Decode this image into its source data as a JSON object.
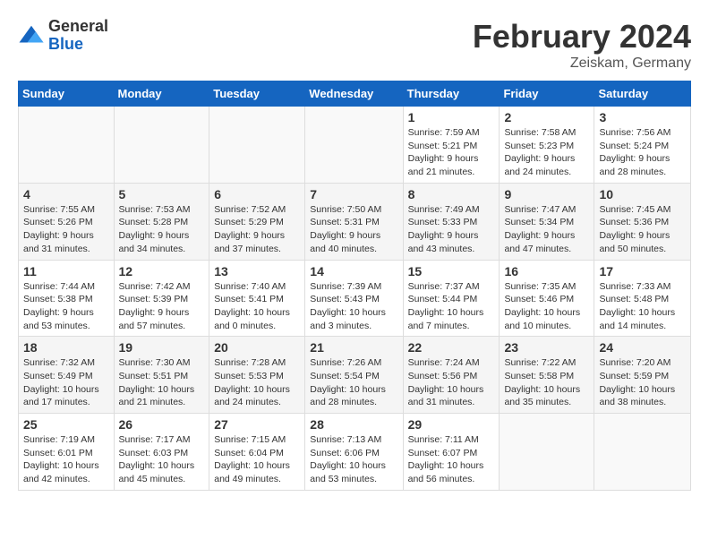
{
  "logo": {
    "general": "General",
    "blue": "Blue"
  },
  "title": "February 2024",
  "location": "Zeiskam, Germany",
  "days_header": [
    "Sunday",
    "Monday",
    "Tuesday",
    "Wednesday",
    "Thursday",
    "Friday",
    "Saturday"
  ],
  "weeks": [
    [
      {
        "day": "",
        "info": ""
      },
      {
        "day": "",
        "info": ""
      },
      {
        "day": "",
        "info": ""
      },
      {
        "day": "",
        "info": ""
      },
      {
        "day": "1",
        "info": "Sunrise: 7:59 AM\nSunset: 5:21 PM\nDaylight: 9 hours\nand 21 minutes."
      },
      {
        "day": "2",
        "info": "Sunrise: 7:58 AM\nSunset: 5:23 PM\nDaylight: 9 hours\nand 24 minutes."
      },
      {
        "day": "3",
        "info": "Sunrise: 7:56 AM\nSunset: 5:24 PM\nDaylight: 9 hours\nand 28 minutes."
      }
    ],
    [
      {
        "day": "4",
        "info": "Sunrise: 7:55 AM\nSunset: 5:26 PM\nDaylight: 9 hours\nand 31 minutes."
      },
      {
        "day": "5",
        "info": "Sunrise: 7:53 AM\nSunset: 5:28 PM\nDaylight: 9 hours\nand 34 minutes."
      },
      {
        "day": "6",
        "info": "Sunrise: 7:52 AM\nSunset: 5:29 PM\nDaylight: 9 hours\nand 37 minutes."
      },
      {
        "day": "7",
        "info": "Sunrise: 7:50 AM\nSunset: 5:31 PM\nDaylight: 9 hours\nand 40 minutes."
      },
      {
        "day": "8",
        "info": "Sunrise: 7:49 AM\nSunset: 5:33 PM\nDaylight: 9 hours\nand 43 minutes."
      },
      {
        "day": "9",
        "info": "Sunrise: 7:47 AM\nSunset: 5:34 PM\nDaylight: 9 hours\nand 47 minutes."
      },
      {
        "day": "10",
        "info": "Sunrise: 7:45 AM\nSunset: 5:36 PM\nDaylight: 9 hours\nand 50 minutes."
      }
    ],
    [
      {
        "day": "11",
        "info": "Sunrise: 7:44 AM\nSunset: 5:38 PM\nDaylight: 9 hours\nand 53 minutes."
      },
      {
        "day": "12",
        "info": "Sunrise: 7:42 AM\nSunset: 5:39 PM\nDaylight: 9 hours\nand 57 minutes."
      },
      {
        "day": "13",
        "info": "Sunrise: 7:40 AM\nSunset: 5:41 PM\nDaylight: 10 hours\nand 0 minutes."
      },
      {
        "day": "14",
        "info": "Sunrise: 7:39 AM\nSunset: 5:43 PM\nDaylight: 10 hours\nand 3 minutes."
      },
      {
        "day": "15",
        "info": "Sunrise: 7:37 AM\nSunset: 5:44 PM\nDaylight: 10 hours\nand 7 minutes."
      },
      {
        "day": "16",
        "info": "Sunrise: 7:35 AM\nSunset: 5:46 PM\nDaylight: 10 hours\nand 10 minutes."
      },
      {
        "day": "17",
        "info": "Sunrise: 7:33 AM\nSunset: 5:48 PM\nDaylight: 10 hours\nand 14 minutes."
      }
    ],
    [
      {
        "day": "18",
        "info": "Sunrise: 7:32 AM\nSunset: 5:49 PM\nDaylight: 10 hours\nand 17 minutes."
      },
      {
        "day": "19",
        "info": "Sunrise: 7:30 AM\nSunset: 5:51 PM\nDaylight: 10 hours\nand 21 minutes."
      },
      {
        "day": "20",
        "info": "Sunrise: 7:28 AM\nSunset: 5:53 PM\nDaylight: 10 hours\nand 24 minutes."
      },
      {
        "day": "21",
        "info": "Sunrise: 7:26 AM\nSunset: 5:54 PM\nDaylight: 10 hours\nand 28 minutes."
      },
      {
        "day": "22",
        "info": "Sunrise: 7:24 AM\nSunset: 5:56 PM\nDaylight: 10 hours\nand 31 minutes."
      },
      {
        "day": "23",
        "info": "Sunrise: 7:22 AM\nSunset: 5:58 PM\nDaylight: 10 hours\nand 35 minutes."
      },
      {
        "day": "24",
        "info": "Sunrise: 7:20 AM\nSunset: 5:59 PM\nDaylight: 10 hours\nand 38 minutes."
      }
    ],
    [
      {
        "day": "25",
        "info": "Sunrise: 7:19 AM\nSunset: 6:01 PM\nDaylight: 10 hours\nand 42 minutes."
      },
      {
        "day": "26",
        "info": "Sunrise: 7:17 AM\nSunset: 6:03 PM\nDaylight: 10 hours\nand 45 minutes."
      },
      {
        "day": "27",
        "info": "Sunrise: 7:15 AM\nSunset: 6:04 PM\nDaylight: 10 hours\nand 49 minutes."
      },
      {
        "day": "28",
        "info": "Sunrise: 7:13 AM\nSunset: 6:06 PM\nDaylight: 10 hours\nand 53 minutes."
      },
      {
        "day": "29",
        "info": "Sunrise: 7:11 AM\nSunset: 6:07 PM\nDaylight: 10 hours\nand 56 minutes."
      },
      {
        "day": "",
        "info": ""
      },
      {
        "day": "",
        "info": ""
      }
    ]
  ]
}
